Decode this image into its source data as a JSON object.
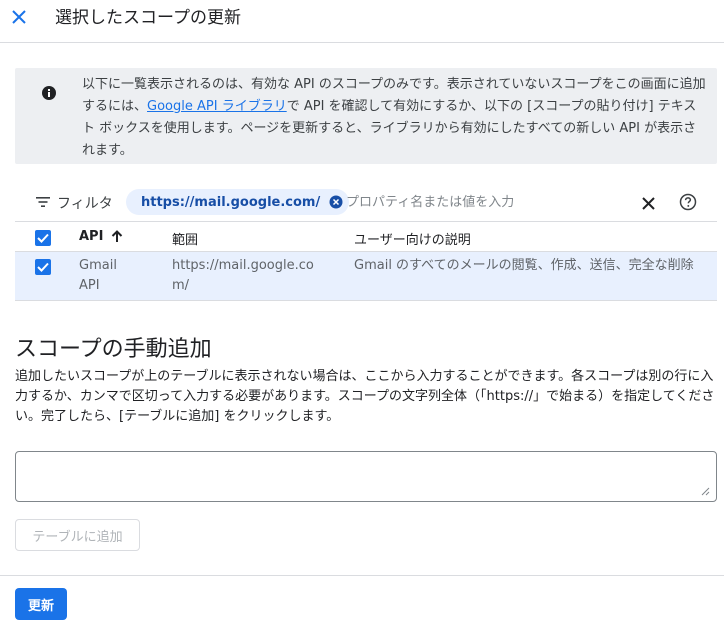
{
  "header": {
    "title": "選択したスコープの更新"
  },
  "info": {
    "text_before": "以下に一覧表示されるのは、有効な API のスコープのみです。表示されていないスコープをこの画面に追加するには、",
    "link": "Google API ライブラリ",
    "text_after": "で API を確認して有効にするか、以下の [スコープの貼り付け] テキスト ボックスを使用します。ページを更新すると、ライブラリから有効にしたすべての新しい API が表示されます。"
  },
  "filter": {
    "label": "フィルタ",
    "chip": "https://mail.google.com/",
    "placeholder": "プロパティ名または値を入力"
  },
  "table": {
    "headers": {
      "api": "API",
      "scope": "範囲",
      "description": "ユーザー向けの説明"
    },
    "rows": [
      {
        "api": "Gmail API",
        "scope": "https://mail.google.com/",
        "description": "Gmail のすべてのメールの閲覧、作成、送信、完全な削除"
      }
    ]
  },
  "manual": {
    "heading": "スコープの手動追加",
    "description": "追加したいスコープが上のテーブルに表示されない場合は、ここから入力することができます。各スコープは別の行に入力するか、カンマで区切って入力する必要があります。スコープの文字列全体（「https://」で始まる）を指定してください。完了したら、[テーブルに追加] をクリックします。",
    "textarea_value": "",
    "add_button": "テーブルに追加"
  },
  "footer": {
    "update_button": "更新"
  },
  "colors": {
    "accent": "#1a73e8",
    "info_bg": "#edeff2",
    "selected_row": "#e8f0fe"
  }
}
